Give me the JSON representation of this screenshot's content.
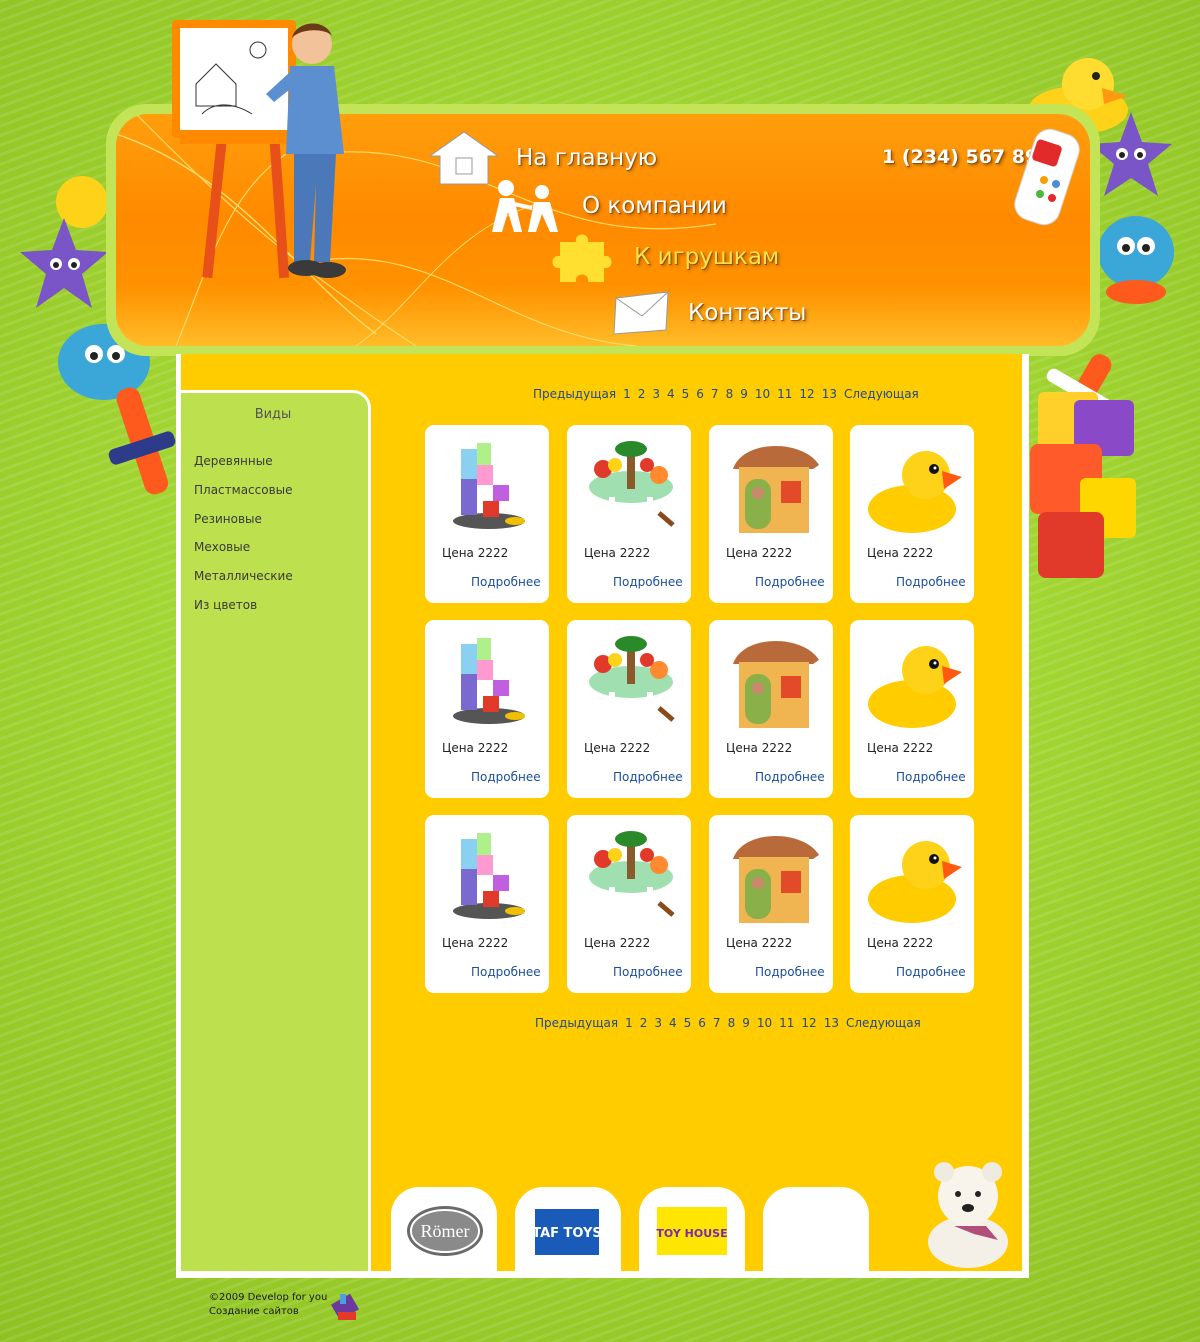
{
  "header": {
    "phone": "1 (234) 567 89 10",
    "nav": [
      {
        "label": "На главную",
        "icon": "home-icon"
      },
      {
        "label": "О компании",
        "icon": "people-icon"
      },
      {
        "label": "К игрушкам",
        "icon": "puzzle-icon",
        "active": true
      },
      {
        "label": "Контакты",
        "icon": "envelope-icon"
      }
    ]
  },
  "sidebar": {
    "title": "Виды",
    "items": [
      {
        "label": "Деревянные"
      },
      {
        "label": "Пластмассовые"
      },
      {
        "label": "Резиновые"
      },
      {
        "label": "Меховые"
      },
      {
        "label": "Металлические"
      },
      {
        "label": "Из цветов"
      }
    ]
  },
  "pagination": {
    "prev": "Предыдущая",
    "next": "Следующая",
    "pages": [
      "1",
      "2",
      "3",
      "4",
      "5",
      "6",
      "7",
      "8",
      "9",
      "10",
      "11",
      "12",
      "13"
    ]
  },
  "products": [
    {
      "image": "block-tower-toy",
      "price": "Цена 2222",
      "more": "Подробнее"
    },
    {
      "image": "flower-table-toy",
      "price": "Цена 2222",
      "more": "Подробнее"
    },
    {
      "image": "playhouse-toy",
      "price": "Цена 2222",
      "more": "Подробнее"
    },
    {
      "image": "rubber-duck-toy",
      "price": "Цена 2222",
      "more": "Подробнее"
    },
    {
      "image": "block-tower-toy",
      "price": "Цена 2222",
      "more": "Подробнее"
    },
    {
      "image": "flower-table-toy",
      "price": "Цена 2222",
      "more": "Подробнее"
    },
    {
      "image": "playhouse-toy",
      "price": "Цена 2222",
      "more": "Подробнее"
    },
    {
      "image": "rubber-duck-toy",
      "price": "Цена 2222",
      "more": "Подробнее"
    },
    {
      "image": "block-tower-toy",
      "price": "Цена 2222",
      "more": "Подробнее"
    },
    {
      "image": "flower-table-toy",
      "price": "Цена 2222",
      "more": "Подробнее"
    },
    {
      "image": "playhouse-toy",
      "price": "Цена 2222",
      "more": "Подробнее"
    },
    {
      "image": "rubber-duck-toy",
      "price": "Цена 2222",
      "more": "Подробнее"
    }
  ],
  "brands": [
    {
      "name": "Römer",
      "logo": "romer-logo"
    },
    {
      "name": "TAF TOYS",
      "logo": "taf-toys-logo"
    },
    {
      "name": "TOY HOUSE",
      "logo": "toy-house-logo"
    },
    {
      "name": "",
      "logo": "empty-brand-slot"
    }
  ],
  "footer": {
    "copyright": "©2009 Develop for you",
    "tagline": "Создание сайтов"
  },
  "colors": {
    "page_background": "#96c82a",
    "header_orange": "#ff8a00",
    "header_border": "#c4e458",
    "content_yellow": "#ffcc00",
    "sidebar_green": "#bde04f",
    "link_blue": "#1a4f99",
    "active_nav": "#ffe34a"
  }
}
